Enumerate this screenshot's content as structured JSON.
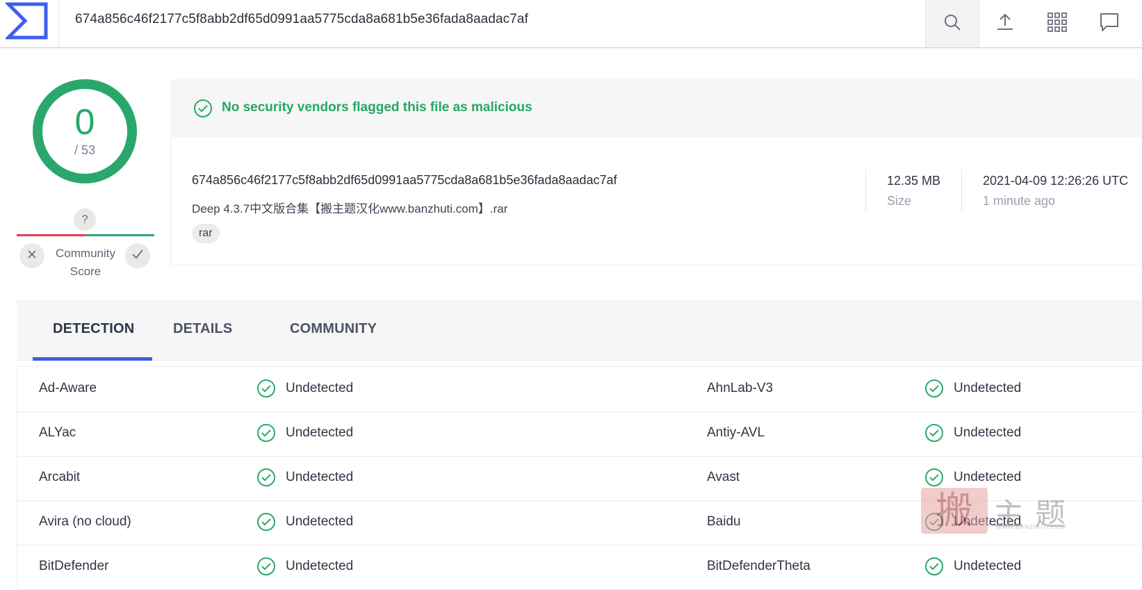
{
  "header": {
    "search_value": "674a856c46f2177c5f8abb2df65d0991aa5775cda8a681b5e36fada8aadac7af",
    "icons": [
      "virustotal-logo-icon",
      "search-icon",
      "upload-icon",
      "apps-grid-icon",
      "chat-icon"
    ]
  },
  "score": {
    "detections": "0",
    "total": "/ 53",
    "community_question": "?",
    "community_label_line1": "Community",
    "community_label_line2": "Score"
  },
  "summary": {
    "banner": "No security vendors flagged this file as malicious",
    "hash": "674a856c46f2177c5f8abb2df65d0991aa5775cda8a681b5e36fada8aadac7af",
    "file_name": "Deep 4.3.7中文版合集【搬主题汉化www.banzhuti.com】.rar",
    "tag": "rar",
    "size_value": "12.35 MB",
    "size_label": "Size",
    "date_value": "2021-04-09 12:26:26 UTC",
    "date_label": "1 minute ago"
  },
  "tabs": [
    "DETECTION",
    "DETAILS",
    "COMMUNITY"
  ],
  "detections": [
    {
      "left_vendor": "Ad-Aware",
      "left_status": "Undetected",
      "right_vendor": "AhnLab-V3",
      "right_status": "Undetected"
    },
    {
      "left_vendor": "ALYac",
      "left_status": "Undetected",
      "right_vendor": "Antiy-AVL",
      "right_status": "Undetected"
    },
    {
      "left_vendor": "Arcabit",
      "left_status": "Undetected",
      "right_vendor": "Avast",
      "right_status": "Undetected"
    },
    {
      "left_vendor": "Avira (no cloud)",
      "left_status": "Undetected",
      "right_vendor": "Baidu",
      "right_status": "Undetected"
    },
    {
      "left_vendor": "BitDefender",
      "left_status": "Undetected",
      "right_vendor": "BitDefenderTheta",
      "right_status": "Undetected"
    }
  ],
  "watermark": {
    "seal_char": "搬",
    "text": "主题",
    "url": "WWW.BANZHUTI.COM"
  },
  "colors": {
    "accent_blue": "#3b5fe0",
    "clean_green": "#29a76c",
    "community_red": "#e8385c"
  }
}
